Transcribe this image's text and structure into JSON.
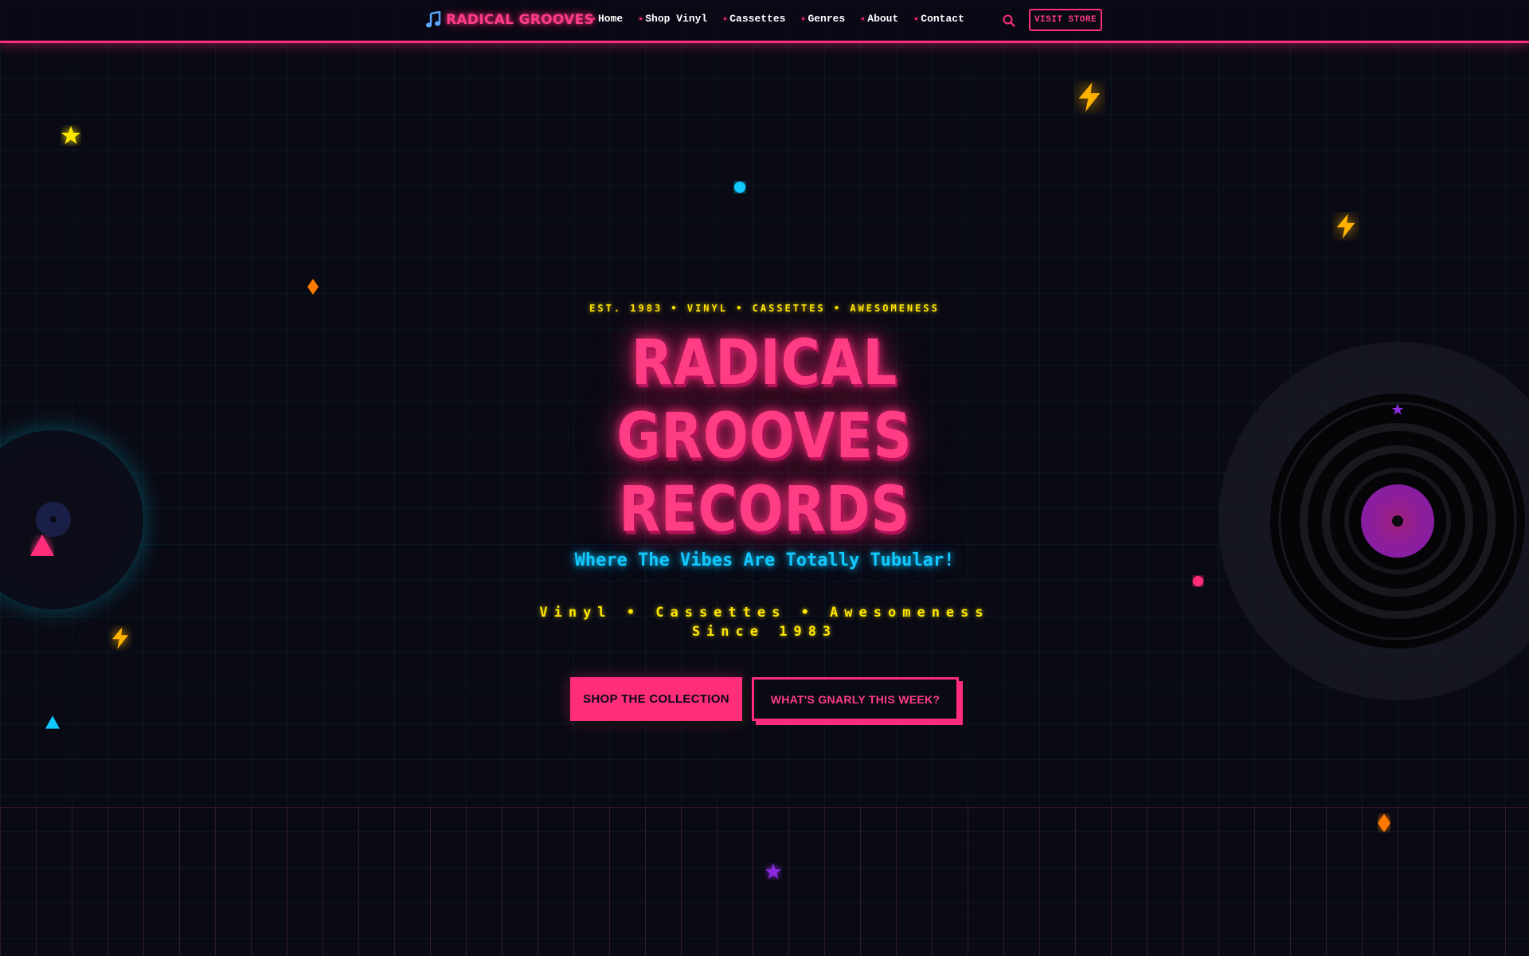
{
  "brand": {
    "name": "RADICAL GROOVES",
    "icon": "music-note-icon",
    "color": "#ff2d7a"
  },
  "nav": {
    "items": [
      {
        "label": "Home"
      },
      {
        "label": "Shop Vinyl"
      },
      {
        "label": "Cassettes"
      },
      {
        "label": "Genres"
      },
      {
        "label": "About"
      },
      {
        "label": "Contact"
      }
    ],
    "search_icon": "search-icon",
    "visit_store_label": "VISIT STORE"
  },
  "hero": {
    "tagline": "EST. 1983 • VINYL • CASSETTES • AWESOMENESS",
    "title_lines": [
      "RADICAL",
      "GROOVES",
      "RECORDS"
    ],
    "subtitle": "Where The Vibes Are Totally Tubular!",
    "subline": "Vinyl • Cassettes • Awesomeness Since 1983",
    "primary_button": "SHOP THE COLLECTION",
    "secondary_button": "WHAT'S GNARLY THIS WEEK?"
  },
  "colors": {
    "background": "#0a0a14",
    "pink": "#ff2d7a",
    "cyan": "#12c8ff",
    "yellow": "#ffe600",
    "orange": "#ff7a00",
    "purple": "#8a2be2"
  },
  "decorations": {
    "icons": [
      "star-icon",
      "lightning-icon",
      "diamond-icon",
      "triangle-icon",
      "dot-icon",
      "vinyl-record-icon"
    ]
  }
}
